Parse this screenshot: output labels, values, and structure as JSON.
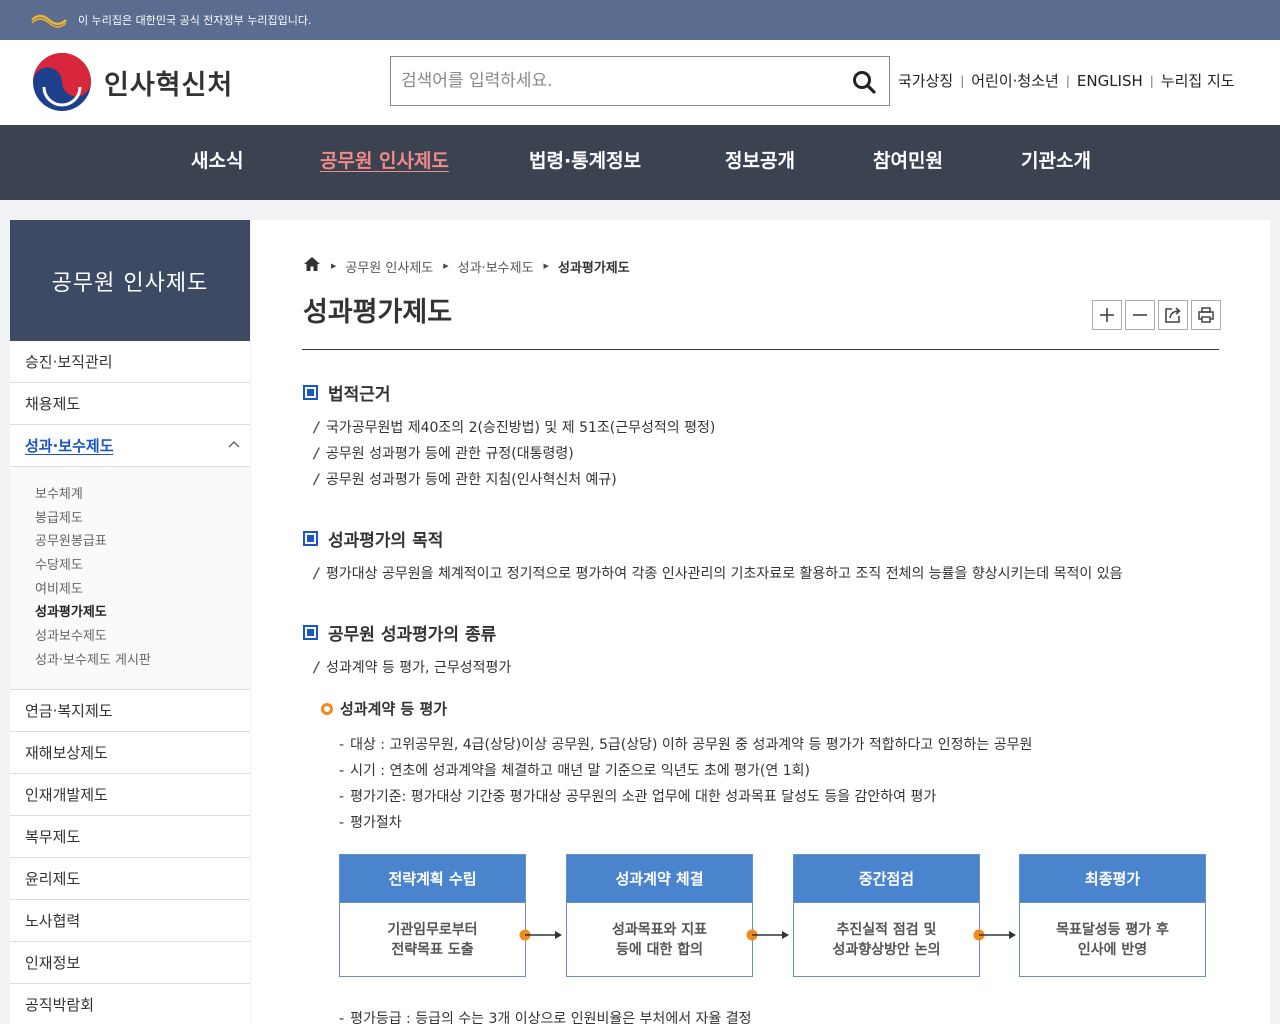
{
  "gov_banner": {
    "text": "이 누리집은 대한민국 공식 전자정부 누리집입니다."
  },
  "header": {
    "logo_text": "인사혁신처",
    "search_placeholder": "검색어를 입력하세요.",
    "util_links": [
      "국가상징",
      "어린이·청소년",
      "ENGLISH",
      "누리집 지도"
    ]
  },
  "gnb": [
    {
      "label": "새소식"
    },
    {
      "label": "공무원 인사제도"
    },
    {
      "label": "법령·통계정보"
    },
    {
      "label": "정보공개"
    },
    {
      "label": "참여민원"
    },
    {
      "label": "기관소개"
    }
  ],
  "lnb": {
    "title": "공무원 인사제도",
    "items_top": [
      "승진·보직관리",
      "채용제도"
    ],
    "open_item": "성과·보수제도",
    "sub_items": [
      "보수체계",
      "봉급제도",
      "공무원봉급표",
      "수당제도",
      "여비제도",
      "성과평가제도",
      "성과보수제도",
      "성과·보수제도 게시판"
    ],
    "items_bottom": [
      "연금·복지제도",
      "재해보상제도",
      "인재개발제도",
      "복무제도",
      "윤리제도",
      "노사협력",
      "인재정보",
      "공직박람회"
    ]
  },
  "breadcrumb": [
    "공무원 인사제도",
    "성과·보수제도",
    "성과평가제도"
  ],
  "page_title": "성과평가제도",
  "sections": {
    "legal": {
      "title": "법적근거",
      "items": [
        "국가공무원법 제40조의 2(승진방법) 및 제 51조(근무성적의 평정)",
        "공무원 성과평가 등에 관한 규정(대통령령)",
        "공무원 성과평가 등에 관한 지침(인사혁신처 예규)"
      ]
    },
    "purpose": {
      "title": "성과평가의 목적",
      "items": [
        "평가대상 공무원을 체계적이고 정기적으로 평가하여 각종 인사관리의 기초자료로 활용하고 조직 전체의 능률을 향상시키는데 목적이 있음"
      ]
    },
    "types": {
      "title": "공무원 성과평가의 종류",
      "items": [
        "성과계약 등 평가, 근무성적평가"
      ],
      "sub_title": "성과계약 등 평가",
      "details": [
        "대상 : 고위공무원, 4급(상당)이상 공무원, 5급(상당) 이하 공무원 중 성과계약 등 평가가 적합하다고 인정하는 공무원",
        "시기 : 연초에 성과계약을 체결하고 매년 말 기준으로 익년도 초에 평가(연 1회)",
        "평가기준: 평가대상 기간중 평가대상 공무원의 소관 업무에 대한 성과목표 달성도 등을 감안하여 평가",
        "평가절차"
      ],
      "process": [
        {
          "title": "전략계획 수립",
          "body": [
            "기관임무로부터",
            "전략목표 도출"
          ]
        },
        {
          "title": "성과계약 체결",
          "body": [
            "성과목표와 지표",
            "등에 대한 합의"
          ]
        },
        {
          "title": "중간점검",
          "body": [
            "추진실적 점검 및",
            "성과향상방안 논의"
          ]
        },
        {
          "title": "최종평가",
          "body": [
            "목표달성등 평가 후",
            "인사에 반영"
          ]
        }
      ],
      "after": "평가등급 : 등급의 수는 3개 이상으로 인원비율은 부처에서 자율 결정"
    }
  },
  "colors": {
    "gnb_bg": "#3c4350",
    "lnb_head": "#3c4a63",
    "accent_blue": "#1a56c4",
    "accent_orange": "#f08a1c",
    "active_menu": "#f08a8a"
  }
}
